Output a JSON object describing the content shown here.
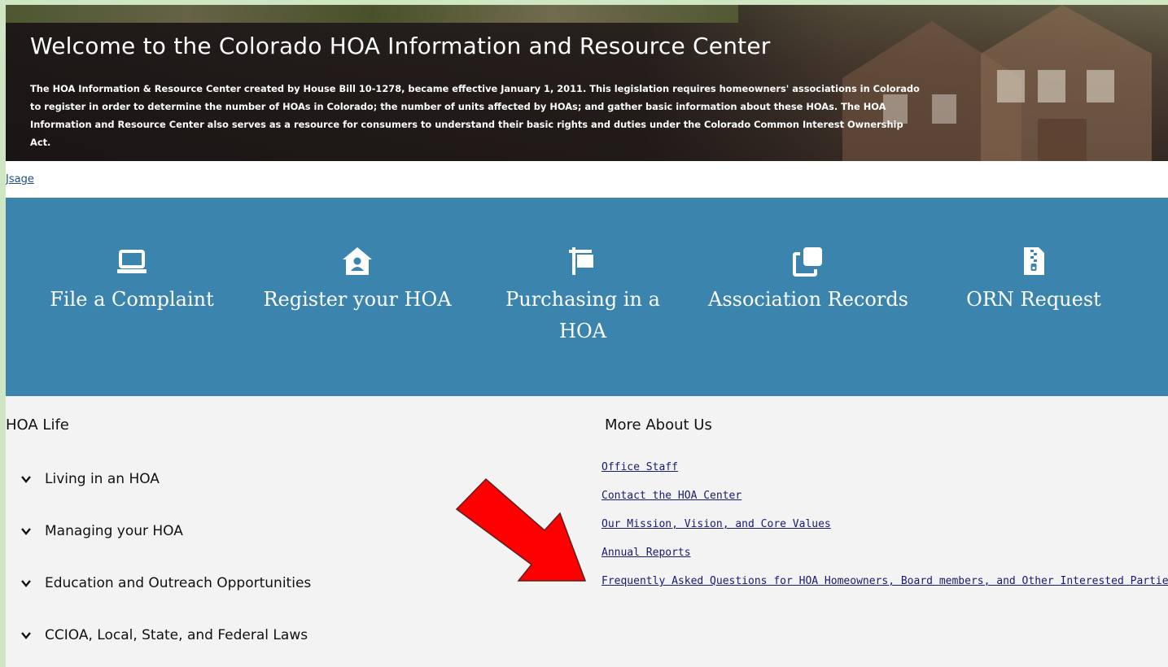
{
  "hero": {
    "title": "Welcome to the Colorado HOA Information and Resource Center",
    "body": "The HOA Information & Resource Center created by House Bill 10-1278, became effective January 1, 2011. This legislation requires homeowners' associations in Colorado to register in order to determine the number of HOAs in Colorado; the number of units affected by HOAs; and gather basic information about these HOAs. The HOA Information and Resource Center also serves as a resource for consumers to understand their basic rights and duties under the Colorado Common Interest Ownership Act."
  },
  "usage_link": "Jsage",
  "tiles": [
    {
      "label": "File a Complaint",
      "icon": "laptop-icon"
    },
    {
      "label": "Register your HOA",
      "icon": "home-user-icon"
    },
    {
      "label": "Purchasing in a HOA",
      "icon": "sign-post-icon"
    },
    {
      "label": "Association Records",
      "icon": "copy-icon"
    },
    {
      "label": "ORN Request",
      "icon": "zip-file-icon"
    }
  ],
  "hoa_life": {
    "title": "HOA Life",
    "items": [
      "Living in an HOA",
      "Managing your HOA",
      "Education and Outreach Opportunities",
      "CCIOA, Local, State, and Federal Laws"
    ]
  },
  "more_about": {
    "title": "More About Us",
    "links": [
      "Office Staff",
      "Contact the HOA Center",
      "Our Mission, Vision, and Core Values",
      "Annual Reports",
      "Frequently Asked Questions for HOA Homeowners, Board members, and Other Interested Parties"
    ]
  },
  "colors": {
    "band": "#3a84ad",
    "link": "#1a1a6e",
    "arrow": "#ff0000",
    "frame": "#cfe6c3"
  }
}
